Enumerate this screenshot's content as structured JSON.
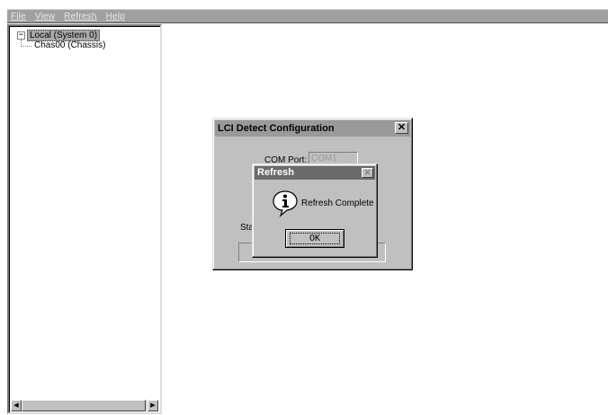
{
  "menubar": {
    "items": [
      "File",
      "View",
      "Refresh",
      "Help"
    ]
  },
  "tree": {
    "root_expand_symbol": "−",
    "root_label": "Local (System 0)",
    "child_label": "Chas00 (Chassis)"
  },
  "scrollbar": {
    "left_arrow": "◀",
    "right_arrow": "▶"
  },
  "lci_dialog": {
    "title": "LCI Detect Configuration",
    "close_symbol": "✕",
    "com_port_label": "COM Port:",
    "com_port_value": "COM1",
    "status_label": "Sta"
  },
  "refresh_dialog": {
    "title": "Refresh",
    "close_symbol": "✕",
    "message": "Refresh Complete",
    "ok_label": "OK",
    "icon": "info-icon"
  }
}
